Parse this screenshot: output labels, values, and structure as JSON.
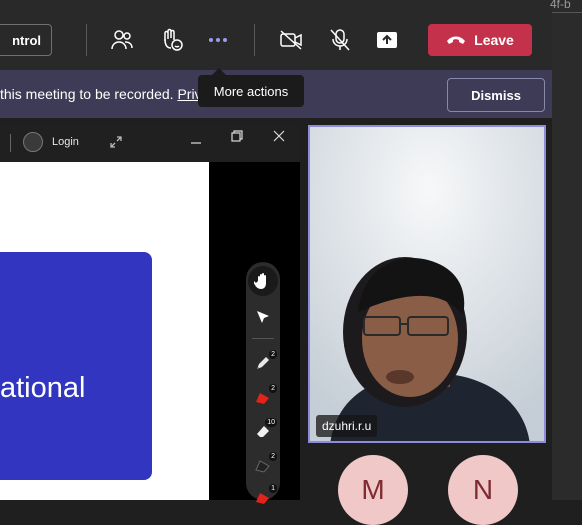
{
  "toolbar": {
    "control_label": "ntrol",
    "leave_label": "Leave",
    "icons": [
      "people-icon",
      "raise-hand-icon",
      "more-actions-icon",
      "camera-off-icon",
      "mic-off-icon",
      "share-icon",
      "phone-hangup-icon"
    ]
  },
  "tooltip": {
    "text": "More actions"
  },
  "banner": {
    "text": "this meeting to be recorded. ",
    "link": "Priv",
    "dismiss_label": "Dismiss"
  },
  "share_window": {
    "login_label": "Login",
    "slide_text": "ational"
  },
  "pen_tools": {
    "badges": [
      "2",
      "2",
      "10",
      "2",
      "1"
    ]
  },
  "video": {
    "participant_name": "dzuhri.r.u"
  },
  "participants": [
    "M",
    "N"
  ],
  "right_strip": {
    "text": "4f-b"
  },
  "colors": {
    "leave": "#c4314b",
    "banner": "#3d3b55",
    "slide_block": "#3235c0",
    "active_speaker_border": "#8e8cd8",
    "avatar_bg": "#f0c8c8"
  }
}
